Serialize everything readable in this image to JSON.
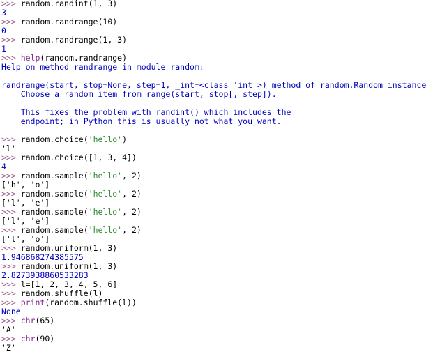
{
  "window": {
    "title": "Python Shell",
    "prompt": ">>> ",
    "colors": {
      "background": "#ffffff",
      "prompt": "#9b5f8c",
      "code": "#000000",
      "builtin": "#80268c",
      "string": "#2d8a36",
      "output": "#0000bb"
    }
  },
  "lines": [
    {
      "kind": "clipped",
      "tokens": [
        {
          "type": "prompt",
          "text": ">>> "
        },
        {
          "type": "code",
          "text": "random."
        },
        {
          "type": "builtin",
          "text": "randint"
        },
        {
          "type": "code",
          "text": "(1, 3)"
        }
      ]
    },
    {
      "kind": "input",
      "tokens": [
        {
          "type": "prompt",
          "text": ">>> "
        },
        {
          "type": "code",
          "text": "random.randint(1, 3)"
        }
      ]
    },
    {
      "kind": "output",
      "tokens": [
        {
          "type": "output",
          "text": "3"
        }
      ]
    },
    {
      "kind": "input",
      "tokens": [
        {
          "type": "prompt",
          "text": ">>> "
        },
        {
          "type": "code",
          "text": "random.randrange(10)"
        }
      ]
    },
    {
      "kind": "output",
      "tokens": [
        {
          "type": "output",
          "text": "0"
        }
      ]
    },
    {
      "kind": "input",
      "tokens": [
        {
          "type": "prompt",
          "text": ">>> "
        },
        {
          "type": "code",
          "text": "random.randrange(1, 3)"
        }
      ]
    },
    {
      "kind": "output",
      "tokens": [
        {
          "type": "output",
          "text": "1"
        }
      ]
    },
    {
      "kind": "input",
      "tokens": [
        {
          "type": "prompt",
          "text": ">>> "
        },
        {
          "type": "builtin",
          "text": "help"
        },
        {
          "type": "code",
          "text": "(random.randrange)"
        }
      ]
    },
    {
      "kind": "output",
      "tokens": [
        {
          "type": "output",
          "text": "Help on method randrange in module random:"
        }
      ]
    },
    {
      "kind": "blank",
      "tokens": [
        {
          "type": "output",
          "text": " "
        }
      ]
    },
    {
      "kind": "output",
      "tokens": [
        {
          "type": "output",
          "text": "randrange(start, stop=None, step=1, _int=<class 'int'>) method of random.Random instance"
        }
      ]
    },
    {
      "kind": "output",
      "tokens": [
        {
          "type": "output",
          "text": "    Choose a random item from range(start, stop[, step])."
        }
      ]
    },
    {
      "kind": "blank",
      "tokens": [
        {
          "type": "output",
          "text": " "
        }
      ]
    },
    {
      "kind": "output",
      "tokens": [
        {
          "type": "output",
          "text": "    This fixes the problem with randint() which includes the"
        }
      ]
    },
    {
      "kind": "output",
      "tokens": [
        {
          "type": "output",
          "text": "    endpoint; in Python this is usually not what you want."
        }
      ]
    },
    {
      "kind": "blank",
      "tokens": [
        {
          "type": "output",
          "text": " "
        }
      ]
    },
    {
      "kind": "input",
      "tokens": [
        {
          "type": "prompt",
          "text": ">>> "
        },
        {
          "type": "code",
          "text": "random.choice("
        },
        {
          "type": "string",
          "text": "'hello'"
        },
        {
          "type": "code",
          "text": ")"
        }
      ]
    },
    {
      "kind": "output",
      "tokens": [
        {
          "type": "plain",
          "text": "'l'"
        }
      ]
    },
    {
      "kind": "input",
      "tokens": [
        {
          "type": "prompt",
          "text": ">>> "
        },
        {
          "type": "code",
          "text": "random.choice([1, 3, 4])"
        }
      ]
    },
    {
      "kind": "output",
      "tokens": [
        {
          "type": "output",
          "text": "4"
        }
      ]
    },
    {
      "kind": "input",
      "tokens": [
        {
          "type": "prompt",
          "text": ">>> "
        },
        {
          "type": "code",
          "text": "random.sample("
        },
        {
          "type": "string",
          "text": "'hello'"
        },
        {
          "type": "code",
          "text": ", 2)"
        }
      ]
    },
    {
      "kind": "output",
      "tokens": [
        {
          "type": "plain",
          "text": "['h', 'o']"
        }
      ]
    },
    {
      "kind": "input",
      "tokens": [
        {
          "type": "prompt",
          "text": ">>> "
        },
        {
          "type": "code",
          "text": "random.sample("
        },
        {
          "type": "string",
          "text": "'hello'"
        },
        {
          "type": "code",
          "text": ", 2)"
        }
      ]
    },
    {
      "kind": "output",
      "tokens": [
        {
          "type": "plain",
          "text": "['l', 'e']"
        }
      ]
    },
    {
      "kind": "input",
      "tokens": [
        {
          "type": "prompt",
          "text": ">>> "
        },
        {
          "type": "code",
          "text": "random.sample("
        },
        {
          "type": "string",
          "text": "'hello'"
        },
        {
          "type": "code",
          "text": ", 2)"
        }
      ]
    },
    {
      "kind": "output",
      "tokens": [
        {
          "type": "plain",
          "text": "['l', 'e']"
        }
      ]
    },
    {
      "kind": "input",
      "tokens": [
        {
          "type": "prompt",
          "text": ">>> "
        },
        {
          "type": "code",
          "text": "random.sample("
        },
        {
          "type": "string",
          "text": "'hello'"
        },
        {
          "type": "code",
          "text": ", 2)"
        }
      ]
    },
    {
      "kind": "output",
      "tokens": [
        {
          "type": "plain",
          "text": "['l', 'o']"
        }
      ]
    },
    {
      "kind": "input",
      "tokens": [
        {
          "type": "prompt",
          "text": ">>> "
        },
        {
          "type": "code",
          "text": "random.uniform(1, 3)"
        }
      ]
    },
    {
      "kind": "output",
      "tokens": [
        {
          "type": "output",
          "text": "1.946868274385575"
        }
      ]
    },
    {
      "kind": "input",
      "tokens": [
        {
          "type": "prompt",
          "text": ">>> "
        },
        {
          "type": "code",
          "text": "random.uniform(1, 3)"
        }
      ]
    },
    {
      "kind": "output",
      "tokens": [
        {
          "type": "output",
          "text": "2.8273938860533283"
        }
      ]
    },
    {
      "kind": "input",
      "tokens": [
        {
          "type": "prompt",
          "text": ">>> "
        },
        {
          "type": "code",
          "text": "l=[1, 2, 3, 4, 5, 6]"
        }
      ]
    },
    {
      "kind": "input",
      "tokens": [
        {
          "type": "prompt",
          "text": ">>> "
        },
        {
          "type": "code",
          "text": "random.shuffle(l)"
        }
      ]
    },
    {
      "kind": "input",
      "tokens": [
        {
          "type": "prompt",
          "text": ">>> "
        },
        {
          "type": "builtin",
          "text": "print"
        },
        {
          "type": "code",
          "text": "(random.shuffle(l))"
        }
      ]
    },
    {
      "kind": "output",
      "tokens": [
        {
          "type": "output",
          "text": "None"
        }
      ]
    },
    {
      "kind": "input",
      "tokens": [
        {
          "type": "prompt",
          "text": ">>> "
        },
        {
          "type": "builtin",
          "text": "chr"
        },
        {
          "type": "code",
          "text": "(65)"
        }
      ]
    },
    {
      "kind": "output",
      "tokens": [
        {
          "type": "plain",
          "text": "'A'"
        }
      ]
    },
    {
      "kind": "input",
      "tokens": [
        {
          "type": "prompt",
          "text": ">>> "
        },
        {
          "type": "builtin",
          "text": "chr"
        },
        {
          "type": "code",
          "text": "(90)"
        }
      ]
    },
    {
      "kind": "output",
      "tokens": [
        {
          "type": "plain",
          "text": "'Z'"
        }
      ]
    }
  ]
}
